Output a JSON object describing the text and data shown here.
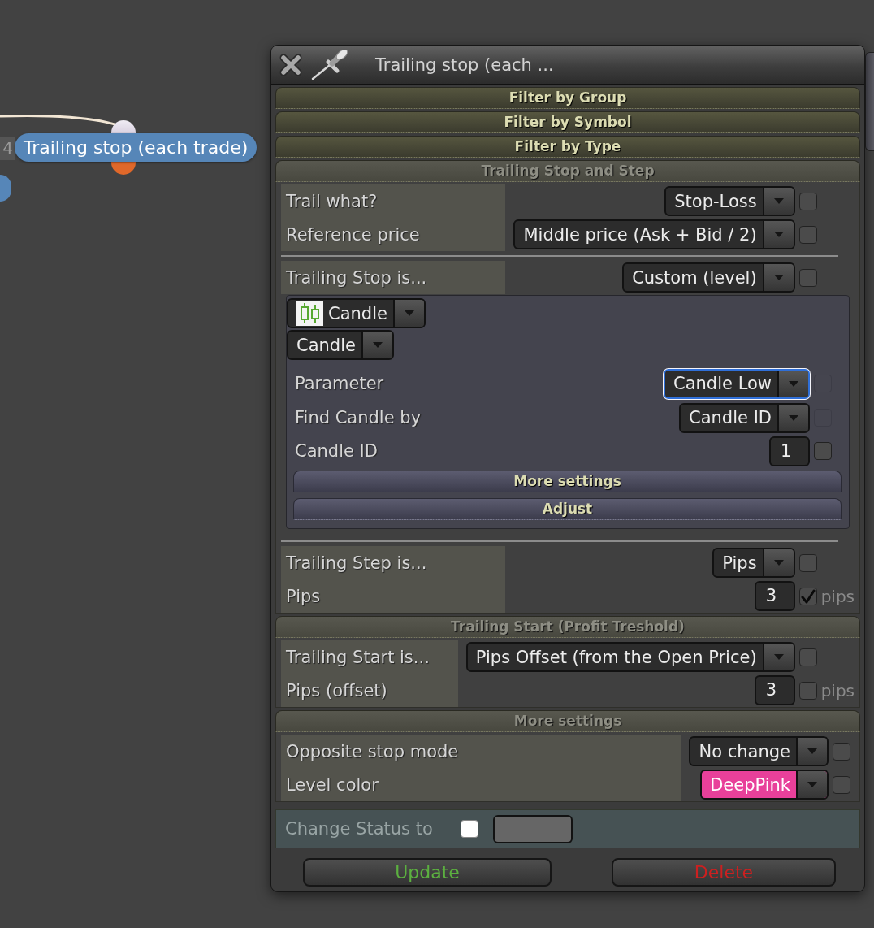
{
  "canvas": {
    "node_index": "4",
    "node_title": "Trailing stop (each trade)"
  },
  "dialog": {
    "title": "Trailing stop (each ...",
    "sections": [
      {
        "title": "Filter by Group",
        "expanded": false
      },
      {
        "title": "Filter by Symbol",
        "expanded": false
      },
      {
        "title": "Filter by Type",
        "expanded": false
      },
      {
        "title": "Trailing Stop and Step",
        "expanded": true,
        "rows": [
          {
            "kind": "select",
            "label": "Trail what?",
            "value": "Stop-Loss",
            "checked": false
          },
          {
            "kind": "select",
            "label": "Reference price",
            "value": "Middle price (Ask + Bid / 2)",
            "checked": false
          },
          {
            "kind": "divider"
          },
          {
            "kind": "select",
            "label": "Trailing Stop is...",
            "value": "Custom (level)",
            "checked": false
          },
          {
            "kind": "panel",
            "source": {
              "value": "Candle"
            },
            "type": {
              "value": "Candle"
            },
            "rows": [
              {
                "kind": "select",
                "label": "Parameter",
                "value": "Candle Low",
                "checked": false,
                "focused": true,
                "check_disabled": true
              },
              {
                "kind": "select",
                "label": "Find Candle by",
                "value": "Candle ID",
                "checked": false,
                "focused": false,
                "check_disabled": true
              },
              {
                "kind": "number",
                "label": "Candle ID",
                "value": "1",
                "checked": false,
                "focused": false,
                "check_disabled": false
              }
            ],
            "subsections": [
              {
                "title": "More settings",
                "expanded": false
              },
              {
                "title": "Adjust",
                "expanded": false
              }
            ]
          },
          {
            "kind": "divider"
          },
          {
            "kind": "select",
            "label": "Trailing Step is...",
            "value": "Pips",
            "checked": false
          },
          {
            "kind": "number",
            "label": "Pips",
            "value": "3",
            "checked": true,
            "unit": "pips"
          }
        ]
      },
      {
        "title": "Trailing Start (Profit Treshold)",
        "expanded": true,
        "rows": [
          {
            "kind": "select",
            "label": "Trailing Start is...",
            "value": "Pips Offset (from the Open Price)",
            "checked": false
          },
          {
            "kind": "number",
            "label": "Pips (offset)",
            "value": "3",
            "checked": false,
            "unit": "pips"
          }
        ]
      },
      {
        "title": "More settings",
        "expanded": true,
        "rows": [
          {
            "kind": "select",
            "label": "Opposite stop mode",
            "value": "No change",
            "checked": false
          },
          {
            "kind": "color_select",
            "label": "Level color",
            "value": "DeepPink",
            "color": "#e8409a",
            "checked": false
          }
        ]
      }
    ],
    "status": {
      "label": "Change Status to",
      "checked": false
    },
    "buttons": [
      {
        "kind": "update",
        "label": "Update"
      },
      {
        "kind": "delete",
        "label": "Delete"
      }
    ]
  }
}
